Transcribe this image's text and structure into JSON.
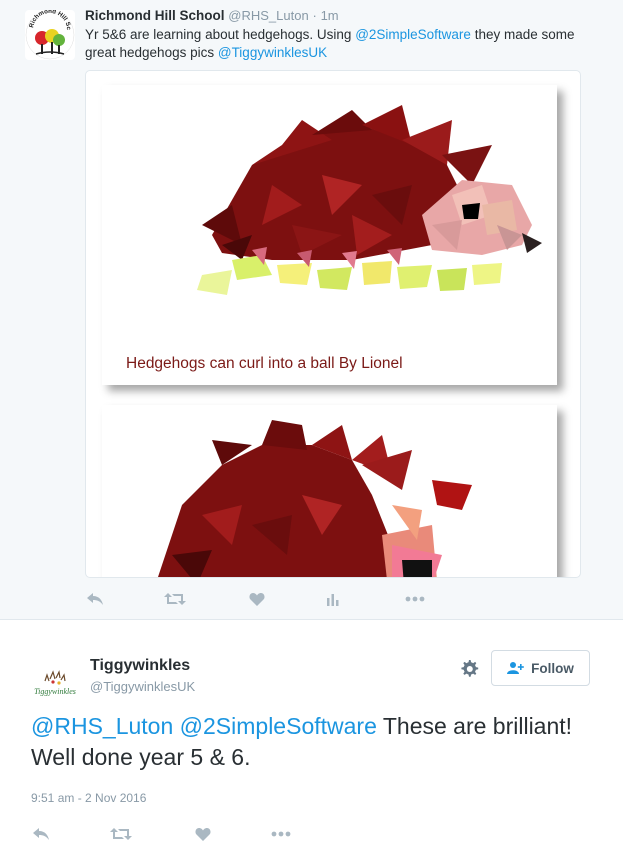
{
  "parent_tweet": {
    "name": "Richmond Hill School",
    "handle": "@RHS_Luton",
    "separator": "·",
    "time": "1m",
    "text_parts": [
      {
        "text": "Yr 5&6 are learning about hedgehogs. Using ",
        "link": false
      },
      {
        "text": "@2SimpleSoftware",
        "link": true
      },
      {
        "text": " they made some great hedgehogs pics ",
        "link": false
      },
      {
        "text": "@TiggywinklesUK",
        "link": true
      }
    ],
    "avatar_text": "Richmond Hill School",
    "media": {
      "caption": "Hedgehogs can curl into a ball  By Lionel"
    },
    "actions": [
      "reply-icon",
      "retweet-icon",
      "like-icon",
      "analytics-icon",
      "more-icon"
    ]
  },
  "reply_tweet": {
    "name": "Tiggywinkles",
    "handle": "@TiggywinklesUK",
    "avatar_text": "Tiggywinkles",
    "follow_label": "Follow",
    "text_parts": [
      {
        "text": "@RHS_Luton",
        "link": true
      },
      {
        "text": " ",
        "link": false
      },
      {
        "text": "@2SimpleSoftware",
        "link": true
      },
      {
        "text": " These are brilliant! Well done year 5 & 6.",
        "link": false
      }
    ],
    "timestamp": "9:51 am - 2 Nov 2016",
    "actions": [
      "reply-icon",
      "retweet-icon",
      "like-icon",
      "more-icon"
    ]
  },
  "colors": {
    "link": "#1b95e0",
    "muted": "#8899a6",
    "icon": "#aab8c2",
    "caption": "#7b1a17",
    "parent_bg": "#f5f8fa"
  }
}
